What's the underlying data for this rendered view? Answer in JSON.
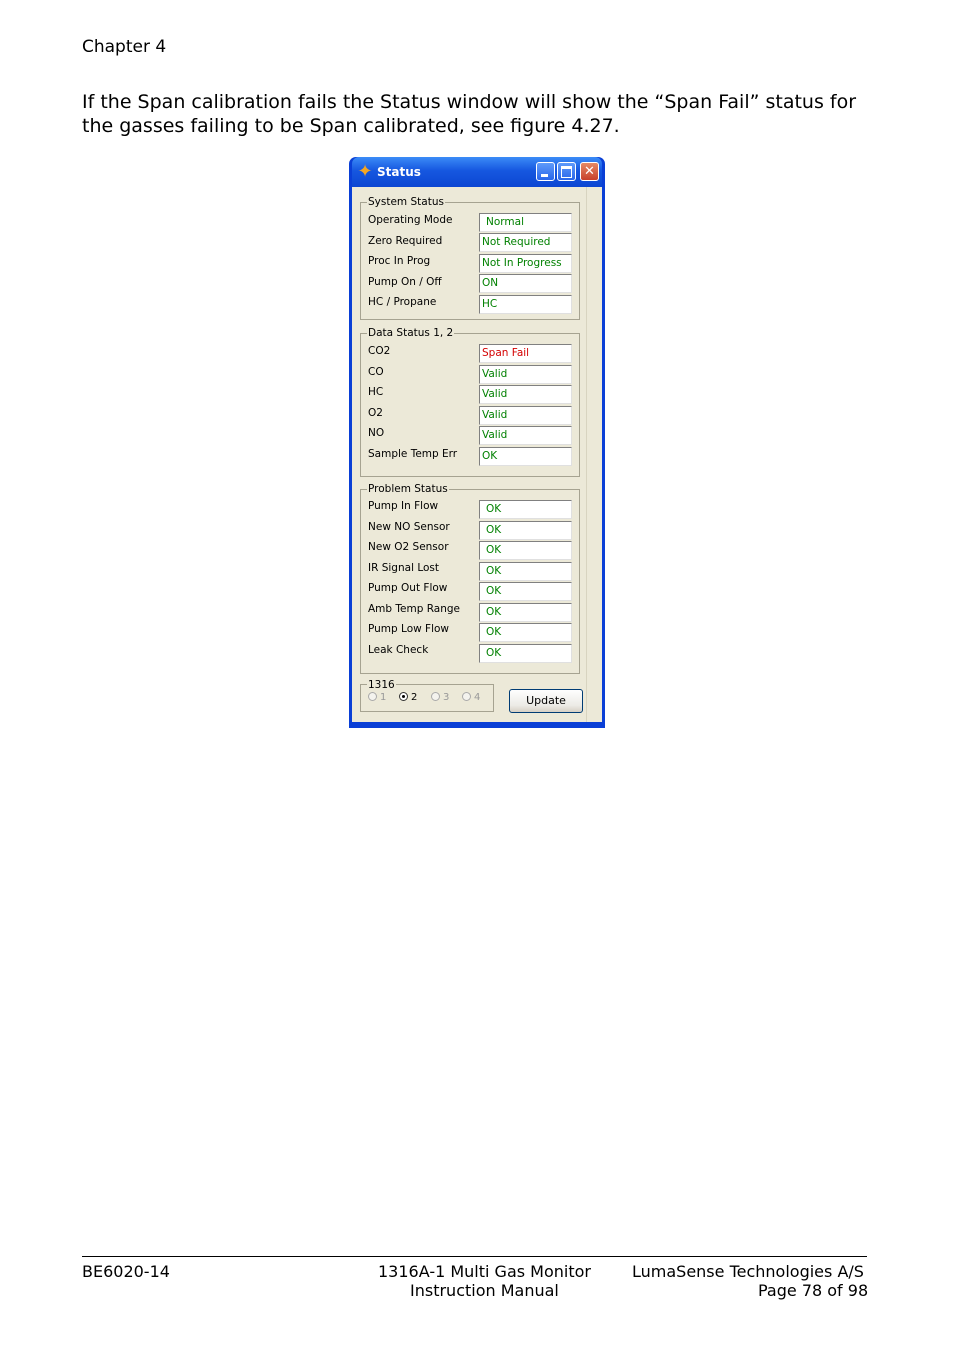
{
  "header": {
    "chapter": "Chapter 4"
  },
  "body": {
    "paragraph": "If the Span calibration fails the Status window will show the “Span Fail” status for the gasses failing to be Span calibrated, see figure 4.27."
  },
  "window": {
    "title": "Status",
    "app_icon": "sparkle-icon",
    "controls": [
      "minimize-icon",
      "maximize-icon",
      "close-icon"
    ],
    "system_status": {
      "legend": "System Status",
      "rows": [
        {
          "label": "Operating Mode",
          "value": "Normal"
        },
        {
          "label": "Zero Required",
          "value": "Not Required"
        },
        {
          "label": "Proc In Prog",
          "value": "Not In Progress"
        },
        {
          "label": "Pump On / Off",
          "value": "ON"
        },
        {
          "label": "HC / Propane",
          "value": "HC"
        }
      ]
    },
    "data_status": {
      "legend": "Data Status 1, 2",
      "rows": [
        {
          "label": "CO2",
          "value": "Span Fail"
        },
        {
          "label": "CO",
          "value": "Valid"
        },
        {
          "label": "HC",
          "value": "Valid"
        },
        {
          "label": "O2",
          "value": "Valid"
        },
        {
          "label": "NO",
          "value": "Valid"
        },
        {
          "label": "Sample Temp Err",
          "value": "OK"
        }
      ]
    },
    "problem_status": {
      "legend": "Problem Status",
      "rows": [
        {
          "label": "Pump In Flow",
          "value": "OK"
        },
        {
          "label": "New NO   Sensor",
          "value": "OK"
        },
        {
          "label": "New O2 Sensor",
          "value": "OK"
        },
        {
          "label": "IR Signal Lost",
          "value": "OK"
        },
        {
          "label": "Pump Out Flow",
          "value": "OK"
        },
        {
          "label": "Amb Temp Range",
          "value": "OK"
        },
        {
          "label": "Pump Low Flow",
          "value": "OK"
        },
        {
          "label": "Leak Check",
          "value": "OK"
        }
      ]
    },
    "channel_group": {
      "legend": "1316",
      "options": [
        "1",
        "2",
        "3",
        "4"
      ],
      "selected": "2"
    },
    "update_label": "Update",
    "colors": {
      "ok": "#008000",
      "fail": "#d40000",
      "titlebar": "#0a3fd6"
    }
  },
  "footer": {
    "doc_id": "BE6020-14",
    "product_line1": "1316A-1 Multi Gas Monitor",
    "product_line2": "Instruction Manual",
    "company": "LumaSense Technologies A/S",
    "page": "Page 78 of 98"
  }
}
